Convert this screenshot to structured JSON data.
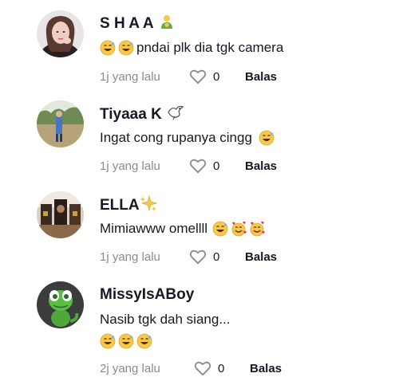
{
  "comments": [
    {
      "username": "S H A A",
      "username_emoji": "person-with-heart-hands-emoji",
      "text": "pndai plk dia tgk camera",
      "text_emoji_prefix": [
        "grinning-sweat-emoji",
        "grinning-sweat-emoji"
      ],
      "text_emoji_suffix": [],
      "time": "1j yang lalu",
      "likes": "0",
      "reply_label": "Balas"
    },
    {
      "username": "Tiyaaa K",
      "username_emoji": "dove-emoji",
      "text": "Ingat cong rupanya cingg",
      "text_emoji_prefix": [],
      "text_emoji_suffix": [
        "grinning-sweat-emoji"
      ],
      "time": "1j yang lalu",
      "likes": "0",
      "reply_label": "Balas"
    },
    {
      "username": "ELLA",
      "username_emoji": "sparkles-emoji",
      "text": "Mimiawww omellll",
      "text_emoji_prefix": [],
      "text_emoji_suffix": [
        "grinning-sweat-emoji",
        "smiling-hearts-emoji",
        "smiling-hearts-emoji"
      ],
      "time": "1j yang lalu",
      "likes": "0",
      "reply_label": "Balas"
    },
    {
      "username": "MissyIsABoy",
      "username_emoji": "",
      "text": "Nasib tgk dah siang...",
      "text_emoji_line2": [
        "grinning-sweat-emoji",
        "grinning-sweat-emoji",
        "grinning-sweat-emoji"
      ],
      "time": "2j yang lalu",
      "likes": "0",
      "reply_label": "Balas"
    }
  ],
  "colors": {
    "text": "#161823",
    "muted": "#8a8b91",
    "background": "#ffffff"
  }
}
